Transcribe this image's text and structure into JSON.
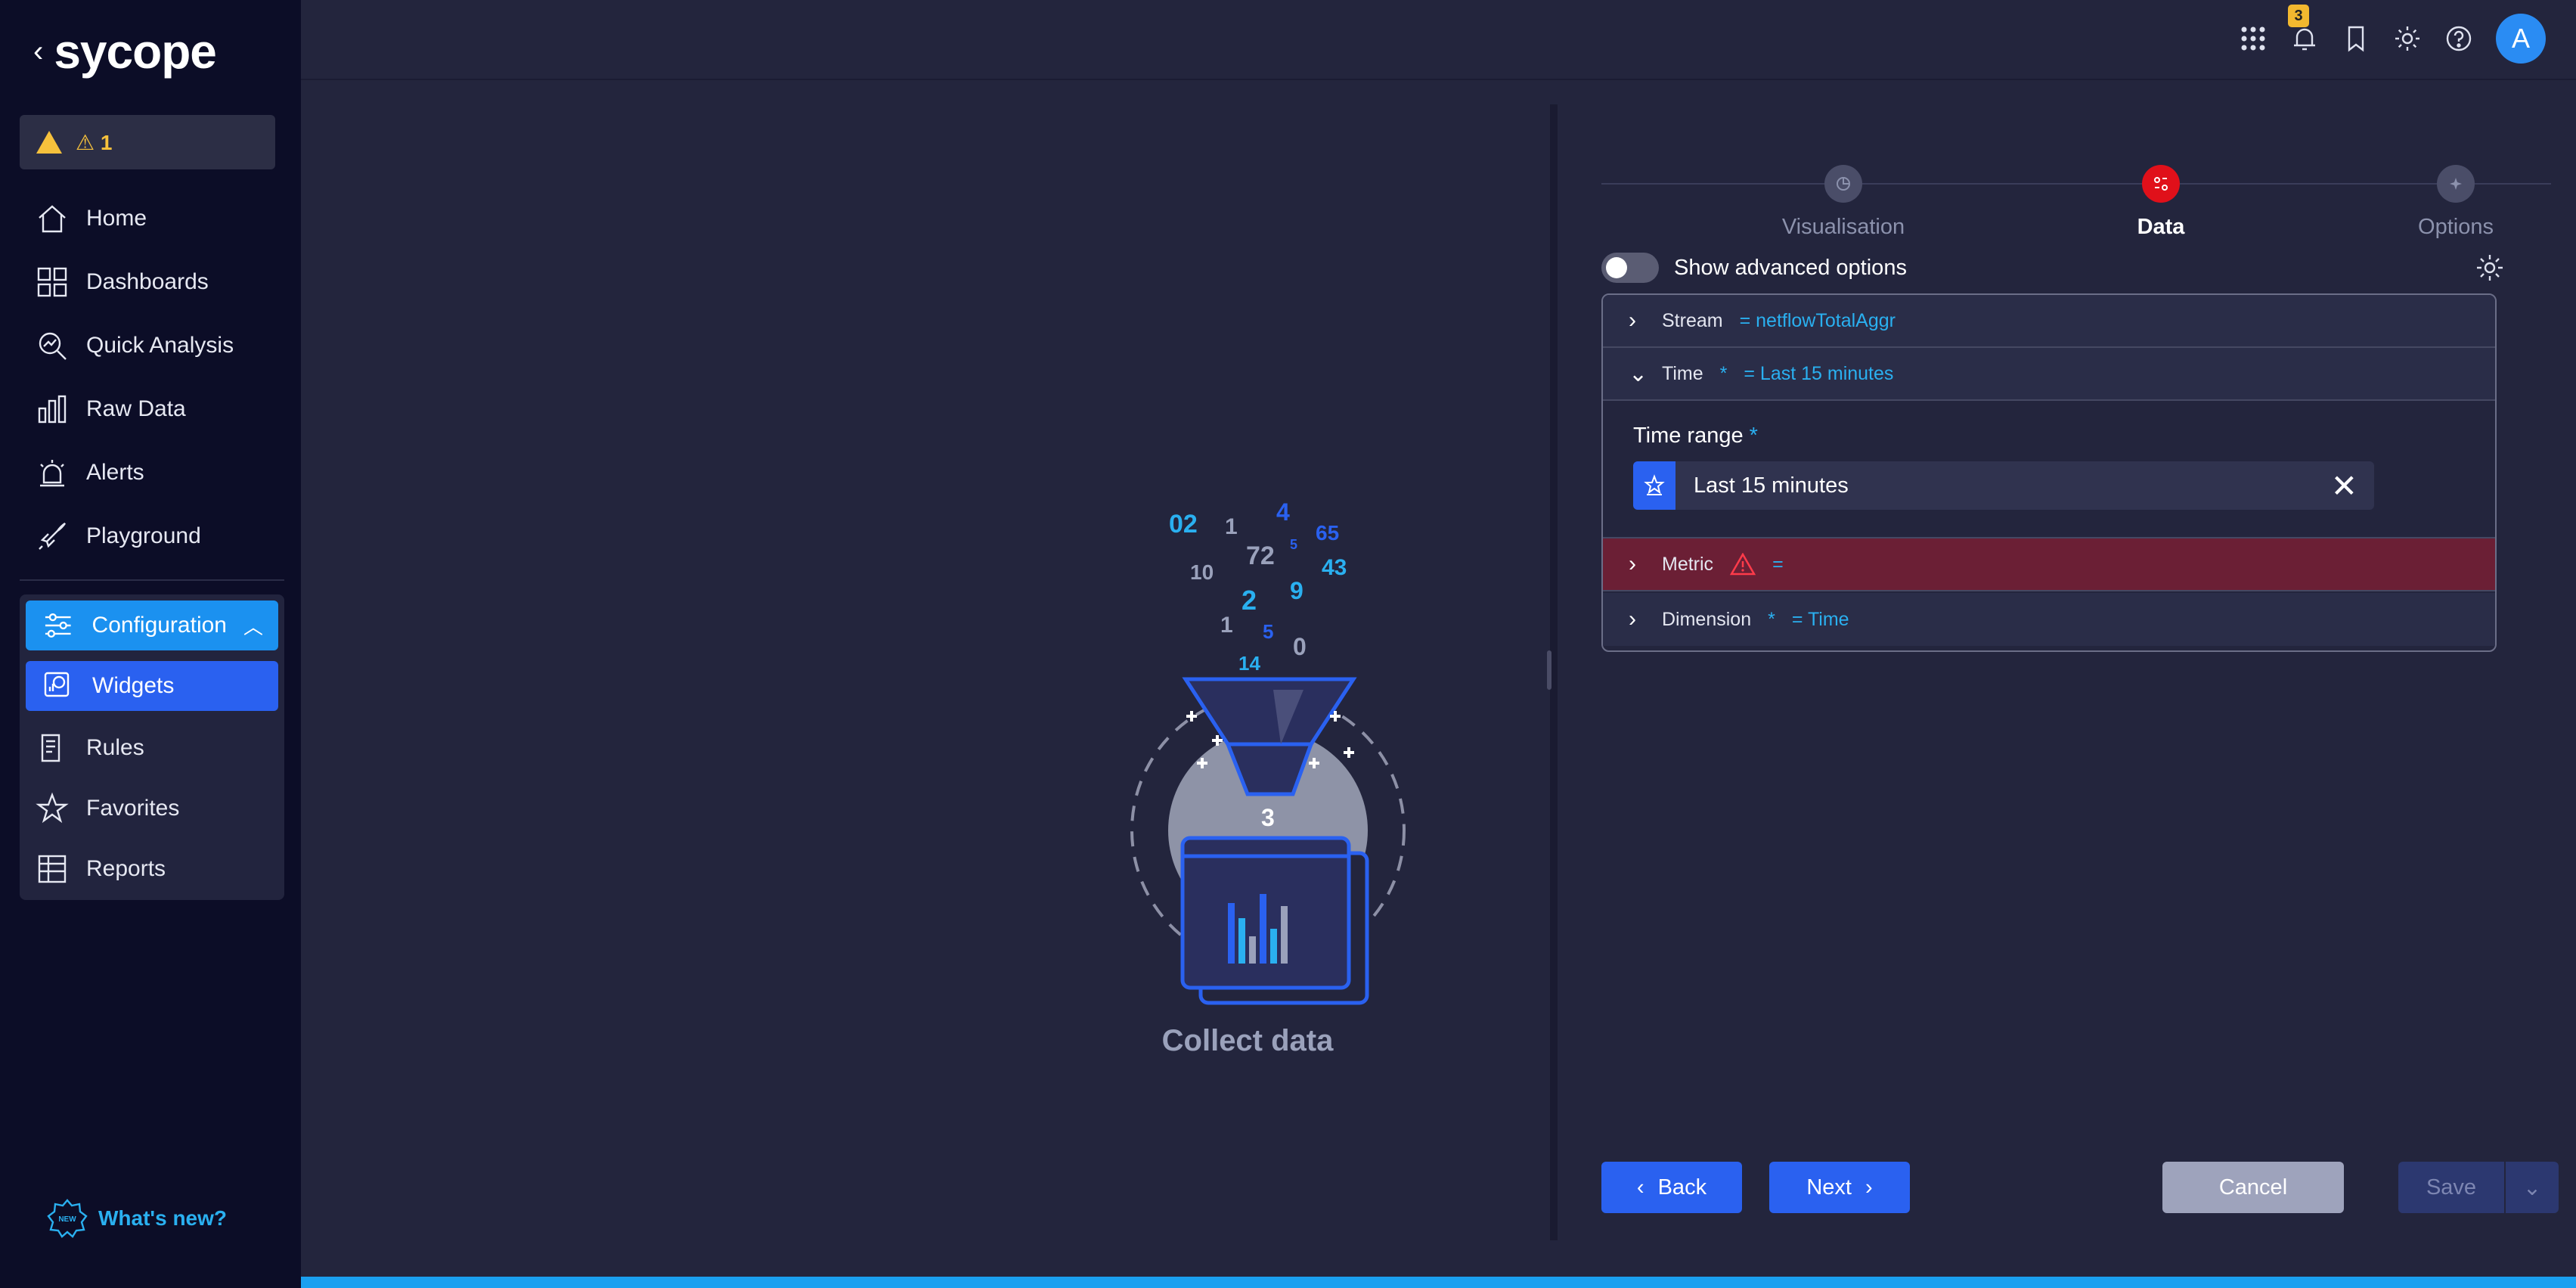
{
  "sidebar": {
    "brand": "sycope",
    "alert_count": "1",
    "items": [
      {
        "label": "Home",
        "icon": "home-icon"
      },
      {
        "label": "Dashboards",
        "icon": "dashboards-icon"
      },
      {
        "label": "Quick Analysis",
        "icon": "quick-analysis-icon"
      },
      {
        "label": "Raw Data",
        "icon": "raw-data-icon"
      },
      {
        "label": "Alerts",
        "icon": "alerts-icon"
      },
      {
        "label": "Playground",
        "icon": "rocket-icon"
      }
    ],
    "config": {
      "label": "Configuration",
      "items": [
        {
          "label": "Widgets",
          "active": true
        },
        {
          "label": "Rules"
        },
        {
          "label": "Favorites"
        },
        {
          "label": "Reports"
        }
      ]
    },
    "whats_new": "What's new?"
  },
  "topbar": {
    "notification_count": "3",
    "avatar": "A"
  },
  "illustration": {
    "numbers": [
      "02",
      "1",
      "4",
      "65",
      "72",
      "5",
      "10",
      "43",
      "2",
      "9",
      "1",
      "5",
      "0",
      "14",
      "3"
    ],
    "caption": "Collect data"
  },
  "steps": [
    {
      "label": "Visualisation"
    },
    {
      "label": "Data",
      "active": true
    },
    {
      "label": "Options"
    }
  ],
  "advanced": {
    "label": "Show advanced options",
    "enabled": false
  },
  "accordion": {
    "stream": {
      "label": "Stream",
      "value": "= netflowTotalAggr"
    },
    "time": {
      "label": "Time",
      "required": "*",
      "value": "= Last 15 minutes",
      "field_label": "Time range",
      "field_required": "*",
      "field_value": "Last 15 minutes"
    },
    "metric": {
      "label": "Metric",
      "value": "="
    },
    "dimension": {
      "label": "Dimension",
      "required": "*",
      "value": "= Time"
    }
  },
  "buttons": {
    "back": "Back",
    "next": "Next",
    "cancel": "Cancel",
    "save": "Save"
  },
  "colors": {
    "accent": "#2a61f0",
    "config_active": "#1b91f0",
    "error": "#6b1f35",
    "link": "#2ab0f0"
  }
}
